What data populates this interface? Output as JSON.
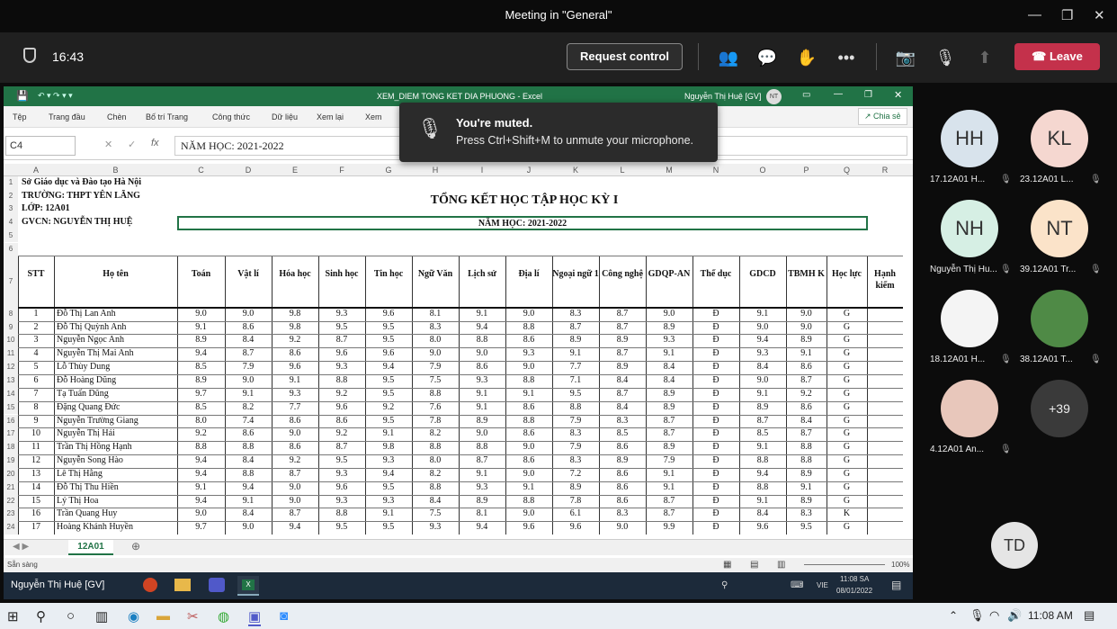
{
  "teams": {
    "window_title": "Meeting in \"General\"",
    "clock": "16:43",
    "request_control": "Request control",
    "leave": "Leave",
    "toast_title": "You're muted.",
    "toast_body": "Press Ctrl+Shift+M to unmute your microphone.",
    "participants": [
      {
        "initials": "HH",
        "name": "17.12A01 H...",
        "bg": "#d8e3ec"
      },
      {
        "initials": "KL",
        "name": "23.12A01 L...",
        "bg": "#f5d7d0"
      },
      {
        "initials": "NH",
        "name": "Nguyễn Thị Hu...",
        "bg": "#d6efe4"
      },
      {
        "initials": "NT",
        "name": "39.12A01 Tr...",
        "bg": "#fbe3c9"
      },
      {
        "initials": "",
        "name": "18.12A01 H...",
        "bg": "#f4f4f4"
      },
      {
        "initials": "",
        "name": "38.12A01 T...",
        "bg": "#4f8a46"
      },
      {
        "initials": "",
        "name": "4.12A01 An...",
        "bg": "#e8c7bb"
      },
      {
        "initials": "+39",
        "name": "",
        "bg": "#3a3a3a"
      }
    ],
    "self_initials": "TD"
  },
  "excel": {
    "file_title": "XEM_DIEM TONG KET DIA PHUONG - Excel",
    "user": "Nguyễn Thị Huệ [GV]",
    "user_initials": "NT",
    "share_label": "Chia sẻ",
    "ribbon_tabs": [
      "Tệp",
      "Trang đầu",
      "Chèn",
      "Bố trí Trang",
      "Công thức",
      "Dữ liệu",
      "Xem lại",
      "Xem"
    ],
    "name_box": "C4",
    "formula": "NĂM HỌC: 2021-2022",
    "columns": [
      "A",
      "B",
      "C",
      "D",
      "E",
      "F",
      "G",
      "H",
      "I",
      "J",
      "K",
      "L",
      "M",
      "N",
      "O",
      "P",
      "Q",
      "R"
    ],
    "info": [
      "Sở Giáo dục và Đào tạo Hà Nội",
      "TRƯỜNG: THPT YÊN LÃNG",
      "LỚP: 12A01",
      "GVCN: NGUYỄN THỊ HUỆ"
    ],
    "sheet_title": "TỔNG KẾT HỌC TẬP HỌC KỲ I",
    "school_year": "NĂM HỌC: 2021-2022",
    "headers": [
      "STT",
      "Họ tên",
      "Toán",
      "Vật lí",
      "Hóa học",
      "Sinh học",
      "Tin học",
      "Ngữ Văn",
      "Lịch sử",
      "Địa lí",
      "Ngoại ngữ 1",
      "Công nghệ",
      "GDQP-AN",
      "Thể dục",
      "GDCD",
      "TBMH K",
      "Học lực",
      "Hạnh kiểm"
    ],
    "students": [
      [
        "1",
        "Đỗ Thị Lan Anh",
        "9.0",
        "9.0",
        "9.8",
        "9.3",
        "9.6",
        "8.1",
        "9.1",
        "9.0",
        "8.3",
        "8.7",
        "9.0",
        "Đ",
        "9.1",
        "9.0",
        "G"
      ],
      [
        "2",
        "Đỗ Thị Quỳnh Anh",
        "9.1",
        "8.6",
        "9.8",
        "9.5",
        "9.5",
        "8.3",
        "9.4",
        "8.8",
        "8.7",
        "8.7",
        "8.9",
        "Đ",
        "9.0",
        "9.0",
        "G"
      ],
      [
        "3",
        "Nguyễn Ngọc Anh",
        "8.9",
        "8.4",
        "9.2",
        "8.7",
        "9.5",
        "8.0",
        "8.8",
        "8.6",
        "8.9",
        "8.9",
        "9.3",
        "Đ",
        "9.4",
        "8.9",
        "G"
      ],
      [
        "4",
        "Nguyễn Thị Mai Anh",
        "9.4",
        "8.7",
        "8.6",
        "9.6",
        "9.6",
        "9.0",
        "9.0",
        "9.3",
        "9.1",
        "8.7",
        "9.1",
        "Đ",
        "9.3",
        "9.1",
        "G"
      ],
      [
        "5",
        "Lỗ Thùy Dung",
        "8.5",
        "7.9",
        "9.6",
        "9.3",
        "9.4",
        "7.9",
        "8.6",
        "9.0",
        "7.7",
        "8.9",
        "8.4",
        "Đ",
        "8.4",
        "8.6",
        "G"
      ],
      [
        "6",
        "Đỗ Hoàng Dũng",
        "8.9",
        "9.0",
        "9.1",
        "8.8",
        "9.5",
        "7.5",
        "9.3",
        "8.8",
        "7.1",
        "8.4",
        "8.4",
        "Đ",
        "9.0",
        "8.7",
        "G"
      ],
      [
        "7",
        "Tạ Tuấn Dũng",
        "9.7",
        "9.1",
        "9.3",
        "9.2",
        "9.5",
        "8.8",
        "9.1",
        "9.1",
        "9.5",
        "8.7",
        "8.9",
        "Đ",
        "9.1",
        "9.2",
        "G"
      ],
      [
        "8",
        "Đặng Quang Đức",
        "8.5",
        "8.2",
        "7.7",
        "9.6",
        "9.2",
        "7.6",
        "9.1",
        "8.6",
        "8.8",
        "8.4",
        "8.9",
        "Đ",
        "8.9",
        "8.6",
        "G"
      ],
      [
        "9",
        "Nguyễn Trường Giang",
        "8.0",
        "7.4",
        "8.6",
        "8.6",
        "9.5",
        "7.8",
        "8.9",
        "8.8",
        "7.9",
        "8.3",
        "8.7",
        "Đ",
        "8.7",
        "8.4",
        "G"
      ],
      [
        "10",
        "Nguyễn Thị Hải",
        "9.2",
        "8.6",
        "9.0",
        "9.2",
        "9.1",
        "8.2",
        "9.0",
        "8.6",
        "8.3",
        "8.5",
        "8.7",
        "Đ",
        "8.5",
        "8.7",
        "G"
      ],
      [
        "11",
        "Trần Thị Hồng Hạnh",
        "8.8",
        "8.8",
        "8.6",
        "8.7",
        "9.8",
        "8.8",
        "8.8",
        "9.0",
        "7.9",
        "8.6",
        "8.9",
        "Đ",
        "9.1",
        "8.8",
        "G"
      ],
      [
        "12",
        "Nguyễn Song Hào",
        "9.4",
        "8.4",
        "9.2",
        "9.5",
        "9.3",
        "8.0",
        "8.7",
        "8.6",
        "8.3",
        "8.9",
        "7.9",
        "Đ",
        "8.8",
        "8.8",
        "G"
      ],
      [
        "13",
        "Lê Thị Hằng",
        "9.4",
        "8.8",
        "8.7",
        "9.3",
        "9.4",
        "8.2",
        "9.1",
        "9.0",
        "7.2",
        "8.6",
        "9.1",
        "Đ",
        "9.4",
        "8.9",
        "G"
      ],
      [
        "14",
        "Đỗ Thị Thu Hiền",
        "9.1",
        "9.4",
        "9.0",
        "9.6",
        "9.5",
        "8.8",
        "9.3",
        "9.1",
        "8.9",
        "8.6",
        "9.1",
        "Đ",
        "8.8",
        "9.1",
        "G"
      ],
      [
        "15",
        "Lý Thị Hoa",
        "9.4",
        "9.1",
        "9.0",
        "9.3",
        "9.3",
        "8.4",
        "8.9",
        "8.8",
        "7.8",
        "8.6",
        "8.7",
        "Đ",
        "9.1",
        "8.9",
        "G"
      ],
      [
        "16",
        "Trần Quang Huy",
        "9.0",
        "8.4",
        "8.7",
        "8.8",
        "9.1",
        "7.5",
        "8.1",
        "9.0",
        "6.1",
        "8.3",
        "8.7",
        "Đ",
        "8.4",
        "8.3",
        "K"
      ],
      [
        "17",
        "Hoàng Khánh Huyền",
        "9.7",
        "9.0",
        "9.4",
        "9.5",
        "9.5",
        "9.3",
        "9.4",
        "9.6",
        "9.6",
        "9.0",
        "9.9",
        "Đ",
        "9.6",
        "9.5",
        "G"
      ]
    ],
    "sheet_tab": "12A01",
    "status": "Sẵn sàng",
    "zoom": "100%",
    "presenter_label": "Nguyễn Thị Huệ [GV]",
    "remote_time": "11:08 SA",
    "remote_date": "08/01/2022",
    "remote_lang": "VIE"
  },
  "windows": {
    "time": "11:08 AM"
  }
}
